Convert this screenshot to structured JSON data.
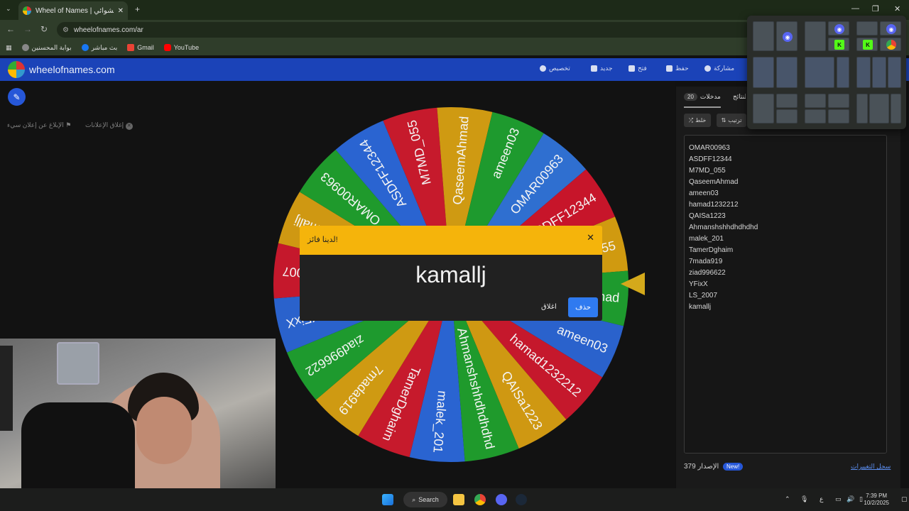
{
  "browser": {
    "tab_title": "Wheel of Names | اسم العشوائي",
    "url": "wheelofnames.com/ar",
    "bookmarks": [
      "بوابة المحسنين",
      "بث مباشر",
      "Gmail",
      "YouTube"
    ]
  },
  "site": {
    "name": "wheelofnames.com",
    "menu": [
      "تخصيص",
      "جديد",
      "فتح",
      "حفظ",
      "مشاركة"
    ],
    "ad_links": [
      "إغلاق الإعلانات",
      "الإبلاغ عن إعلان سيء"
    ]
  },
  "wheel": {
    "segments": [
      "OMAR00963",
      "ASDFF12344",
      "M7MD_055",
      "QaseemAhmad",
      "ameen03",
      "hamad1232212",
      "QAISa1223",
      "Ahmanshshhdhdhdhd",
      "malek_201",
      "TamerDghaim",
      "7mada919",
      "ziad996622",
      "YFixX",
      "LS_2007",
      "kamallj"
    ],
    "colors": [
      "#2f6fd0",
      "#c7152a",
      "#d09a10",
      "#1e9a2e",
      "#2a62cc",
      "#c5182c",
      "#cf9812",
      "#1f9a2c",
      "#2a64d1",
      "#c61a2c",
      "#cf9a12",
      "#1e9a2e",
      "#2a62cc",
      "#c5182c",
      "#cf9812",
      "#1f9a2c",
      "#2a64d1",
      "#c61a2c",
      "#cf9a12",
      "#1e9a2e"
    ]
  },
  "panel": {
    "tab_entries": "مدخلات",
    "entries_count": "20",
    "tab_results": "النتائج",
    "shuffle_label": "خلط",
    "sort_label": "ترتيب",
    "entries": [
      "OMAR00963",
      "ASDFF12344",
      "M7MD_055",
      "QaseemAhmad",
      "ameen03",
      "hamad1232212",
      "QAISa1223",
      "Ahmanshshhdhdhdhd",
      "malek_201",
      "TamerDghaim",
      "7mada919",
      "ziad996622",
      "YFixX",
      "LS_2007",
      "kamallj"
    ],
    "version_label": "الإصدار",
    "version": "379",
    "new_badge": "New!",
    "changelog": "سجل التغييرات"
  },
  "modal": {
    "title": "لدينا فائز!",
    "winner": "kamallj",
    "close_label": "اغلاق",
    "remove_label": "حذف"
  },
  "taskbar": {
    "search": "Search",
    "time": "7:39 PM",
    "date": "10/2/2025",
    "lang": "ع"
  }
}
